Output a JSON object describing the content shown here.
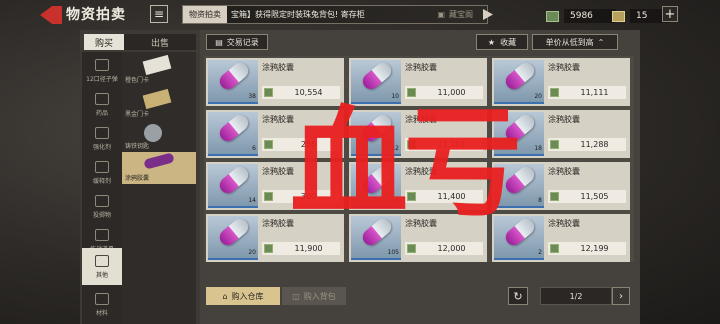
{
  "header": {
    "title": "物资拍卖",
    "menu_icon": "menu-icon",
    "notice_tab": "物资拍卖",
    "notice_text": "宝箱】获得限定时装珠兔背包! 寄存柜",
    "notice_right": "藏宝阁",
    "currency_1": "5986",
    "currency_2": "15",
    "plus_label": "+"
  },
  "left": {
    "tab_buy": "购买",
    "tab_sell": "出售",
    "categories": [
      {
        "label": "12口径子弹",
        "icon": "ammo-icon"
      },
      {
        "label": "药品",
        "icon": "medkit-icon"
      },
      {
        "label": "强化剂",
        "icon": "booster-icon"
      },
      {
        "label": "缓释剂",
        "icon": "flask-icon"
      },
      {
        "label": "投掷物",
        "icon": "grenade-icon"
      },
      {
        "label": "作战道具",
        "icon": "tool-icon"
      },
      {
        "label": "其他",
        "icon": "box-icon"
      },
      {
        "label": "材料",
        "icon": "gear-icon"
      }
    ],
    "subcategories": [
      {
        "label": "橙色门卡"
      },
      {
        "label": "黑金门卡"
      },
      {
        "label": "铸铁钥匙"
      },
      {
        "label": "涂鸦胶囊"
      }
    ]
  },
  "toolbar": {
    "trade_log": "交易记录",
    "favorite": "收藏",
    "sort": "单价从低到高"
  },
  "items": [
    {
      "name": "涂鸦胶囊",
      "qty": "38",
      "price": "10,554"
    },
    {
      "name": "涂鸦胶囊",
      "qty": "10",
      "price": "11,000"
    },
    {
      "name": "涂鸦胶囊",
      "qty": "20",
      "price": "11,111"
    },
    {
      "name": "涂鸦胶囊",
      "qty": "6",
      "price": "255"
    },
    {
      "name": "涂鸦胶囊",
      "qty": "12",
      "price": "11,287"
    },
    {
      "name": "涂鸦胶囊",
      "qty": "18",
      "price": "11,288"
    },
    {
      "name": "涂鸦胶囊",
      "qty": "14",
      "price": "300"
    },
    {
      "name": "涂鸦胶囊",
      "qty": "4",
      "price": "11,400"
    },
    {
      "name": "涂鸦胶囊",
      "qty": "8",
      "price": "11,505"
    },
    {
      "name": "涂鸦胶囊",
      "qty": "20",
      "price": "11,900"
    },
    {
      "name": "涂鸦胶囊",
      "qty": "105",
      "price": "12,000"
    },
    {
      "name": "涂鸦胶囊",
      "qty": "2",
      "price": "12,199"
    }
  ],
  "watermark": "血亏",
  "bottom": {
    "warehouse": "购入仓库",
    "backpack": "购入背包",
    "page": "1/2",
    "next": "›",
    "refresh": "↻"
  },
  "colors": {
    "accent_red": "#c8312c",
    "active_tab": "#cbb683",
    "card_bg": "#d6d1c5",
    "currency_green": "#6c8a55"
  }
}
